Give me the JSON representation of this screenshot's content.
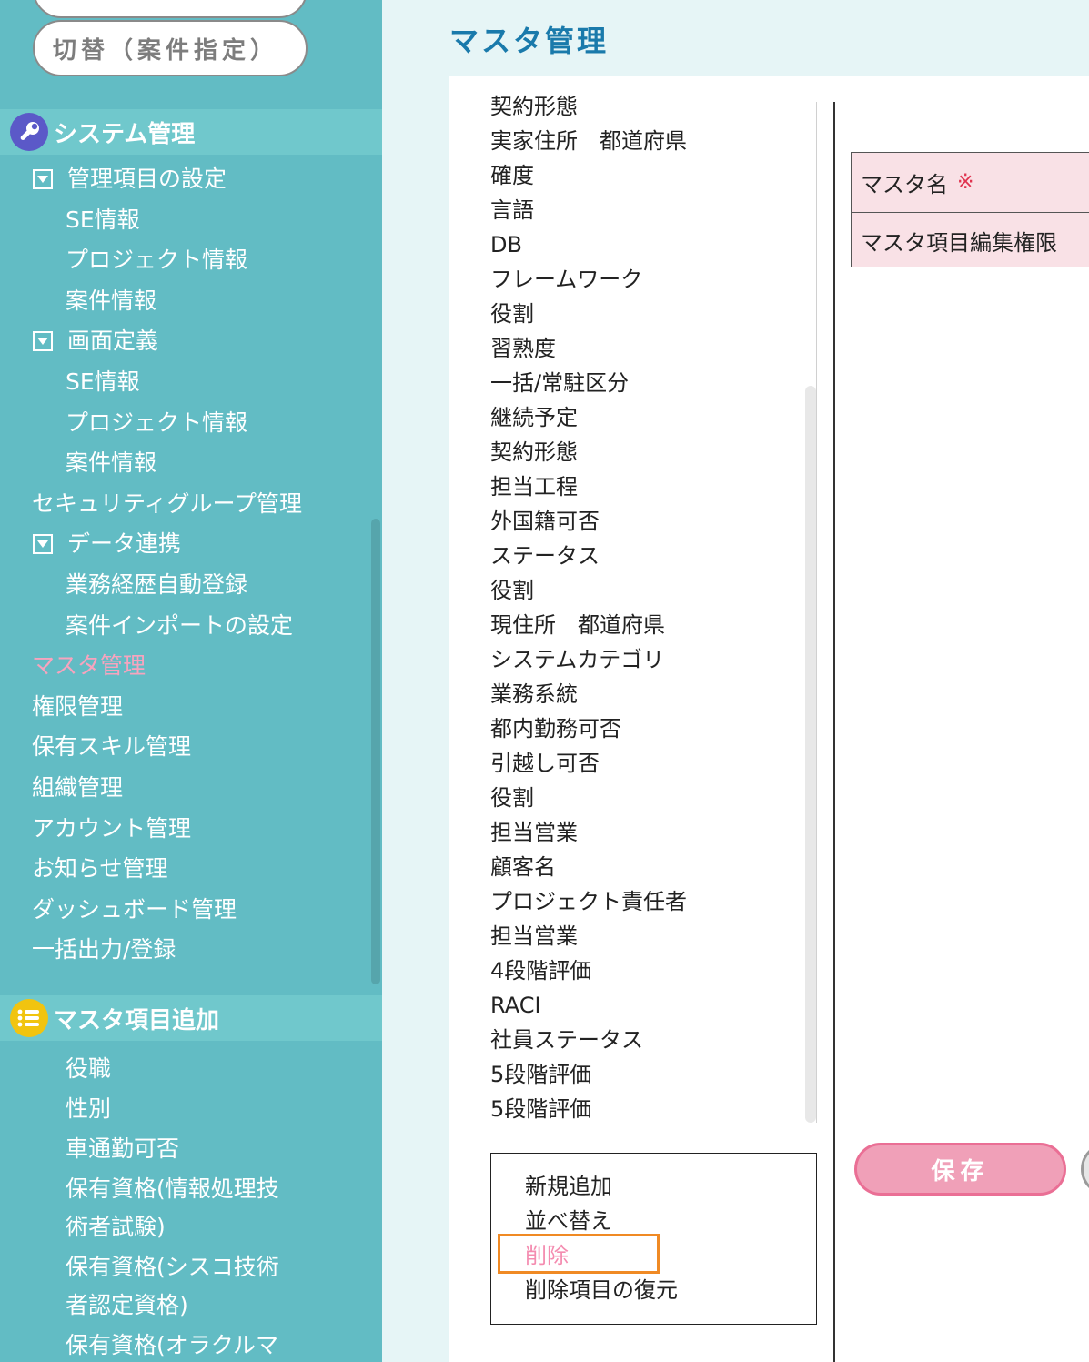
{
  "sidebar": {
    "top_button_label": "",
    "switch_button_label": "切替（案件指定）",
    "sections": {
      "system": {
        "title": "システム管理",
        "icon": "wrench-icon",
        "items": [
          {
            "label": "管理項目の設定",
            "type": "tree"
          },
          {
            "label": "SE情報",
            "type": "child"
          },
          {
            "label": "プロジェクト情報",
            "type": "child"
          },
          {
            "label": "案件情報",
            "type": "child"
          },
          {
            "label": "画面定義",
            "type": "tree"
          },
          {
            "label": "SE情報",
            "type": "child"
          },
          {
            "label": "プロジェクト情報",
            "type": "child"
          },
          {
            "label": "案件情報",
            "type": "child"
          },
          {
            "label": "セキュリティグループ管理",
            "type": "top"
          },
          {
            "label": "データ連携",
            "type": "tree"
          },
          {
            "label": "業務経歴自動登録",
            "type": "child"
          },
          {
            "label": "案件インポートの設定",
            "type": "child"
          },
          {
            "label": "マスタ管理",
            "type": "top",
            "active": true
          },
          {
            "label": "権限管理",
            "type": "top"
          },
          {
            "label": "保有スキル管理",
            "type": "top"
          },
          {
            "label": "組織管理",
            "type": "top"
          },
          {
            "label": "アカウント管理",
            "type": "top"
          },
          {
            "label": "お知らせ管理",
            "type": "top"
          },
          {
            "label": "ダッシュボード管理",
            "type": "top"
          },
          {
            "label": "一括出力/登録",
            "type": "top"
          }
        ]
      },
      "master_add": {
        "title": "マスタ項目追加",
        "icon": "list-icon",
        "items": [
          {
            "label": "役職"
          },
          {
            "label": "性別"
          },
          {
            "label": "車通勤可否"
          },
          {
            "label": "保有資格(情報処理技"
          },
          {
            "label": "術者試験)"
          },
          {
            "label": "保有資格(シスコ技術"
          },
          {
            "label": "者認定資格)"
          },
          {
            "label": "保有資格(オラクルマ"
          }
        ]
      }
    },
    "colors": {
      "background": "#62bcc4",
      "section_header": "#70c8cc",
      "active": "#f7a4be"
    }
  },
  "header": {
    "title": "マスタ管理"
  },
  "master_list": {
    "items": [
      "契約形態",
      "実家住所　都道府県",
      "確度",
      "言語",
      "DB",
      "フレームワーク",
      "役割",
      "習熟度",
      "一括/常駐区分",
      "継続予定",
      "契約形態",
      "担当工程",
      "外国籍可否",
      "ステータス",
      "役割",
      "現住所　都道府県",
      "システムカテゴリ",
      "業務系統",
      "都内勤務可否",
      "引越し可否",
      "役割",
      "担当営業",
      "顧客名",
      "プロジェクト責任者",
      "担当営業",
      "4段階評価",
      "RACI",
      "社員ステータス",
      "5段階評価",
      "5段階評価"
    ]
  },
  "context_menu": {
    "items": [
      {
        "label": "新規追加",
        "highlighted": false
      },
      {
        "label": "並べ替え",
        "highlighted": false
      },
      {
        "label": "削除",
        "highlighted": true
      },
      {
        "label": "削除項目の復元",
        "highlighted": false
      }
    ]
  },
  "form": {
    "master_name_label": "マスタ名",
    "required_mark": "※",
    "edit_permission_label": "マスタ項目編集権限"
  },
  "actions": {
    "save_label": "保存"
  }
}
